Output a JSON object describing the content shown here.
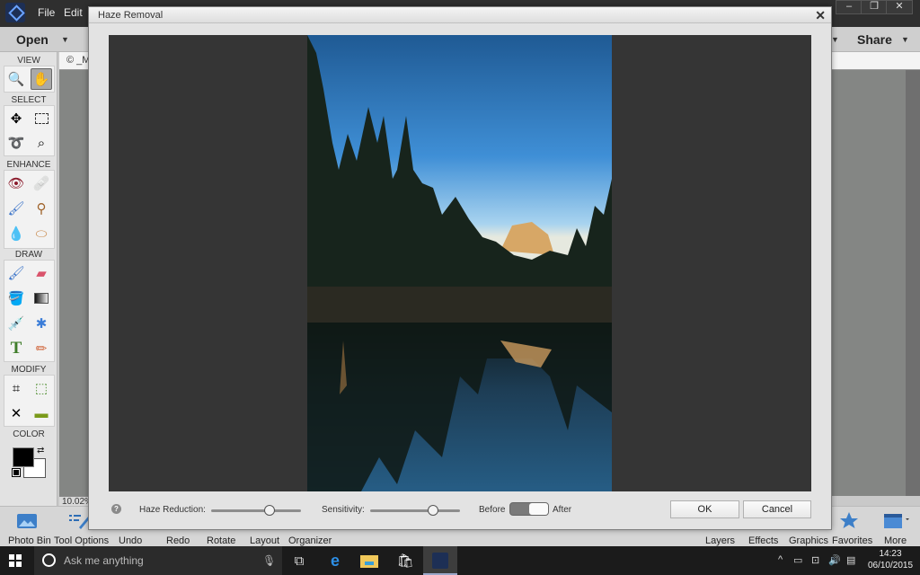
{
  "app": {
    "menu": [
      "File",
      "Edit"
    ],
    "window_controls": {
      "minimize": "–",
      "restore": "❐",
      "close": "✕"
    },
    "header": {
      "open_label": "Open",
      "share_label": "Share"
    },
    "document_tab": "© _M",
    "zoom_status": "10.02%"
  },
  "toolbox": {
    "sections": {
      "view": "VIEW",
      "select": "SELECT",
      "enhance": "ENHANCE",
      "draw": "DRAW",
      "modify": "MODIFY",
      "color": "COLOR"
    },
    "colors": {
      "foreground": "#000000",
      "background": "#ffffff"
    }
  },
  "dialog": {
    "title": "Haze Removal",
    "close_glyph": "✕",
    "haze_reduction": {
      "label": "Haze Reduction:",
      "value": 0.65
    },
    "sensitivity": {
      "label": "Sensitivity:",
      "value": 0.7
    },
    "toggle": {
      "before_label": "Before",
      "after_label": "After",
      "state": "after"
    },
    "ok_label": "OK",
    "cancel_label": "Cancel",
    "help_glyph": "?"
  },
  "bottom_bar": {
    "left": [
      "Photo Bin",
      "Tool Options",
      "Undo",
      "Redo",
      "Rotate",
      "Layout",
      "Organizer"
    ],
    "right": [
      "Layers",
      "Effects",
      "Graphics",
      "Favorites",
      "More"
    ]
  },
  "taskbar": {
    "search_placeholder": "Ask me anything",
    "time": "14:23",
    "date": "06/10/2015"
  }
}
